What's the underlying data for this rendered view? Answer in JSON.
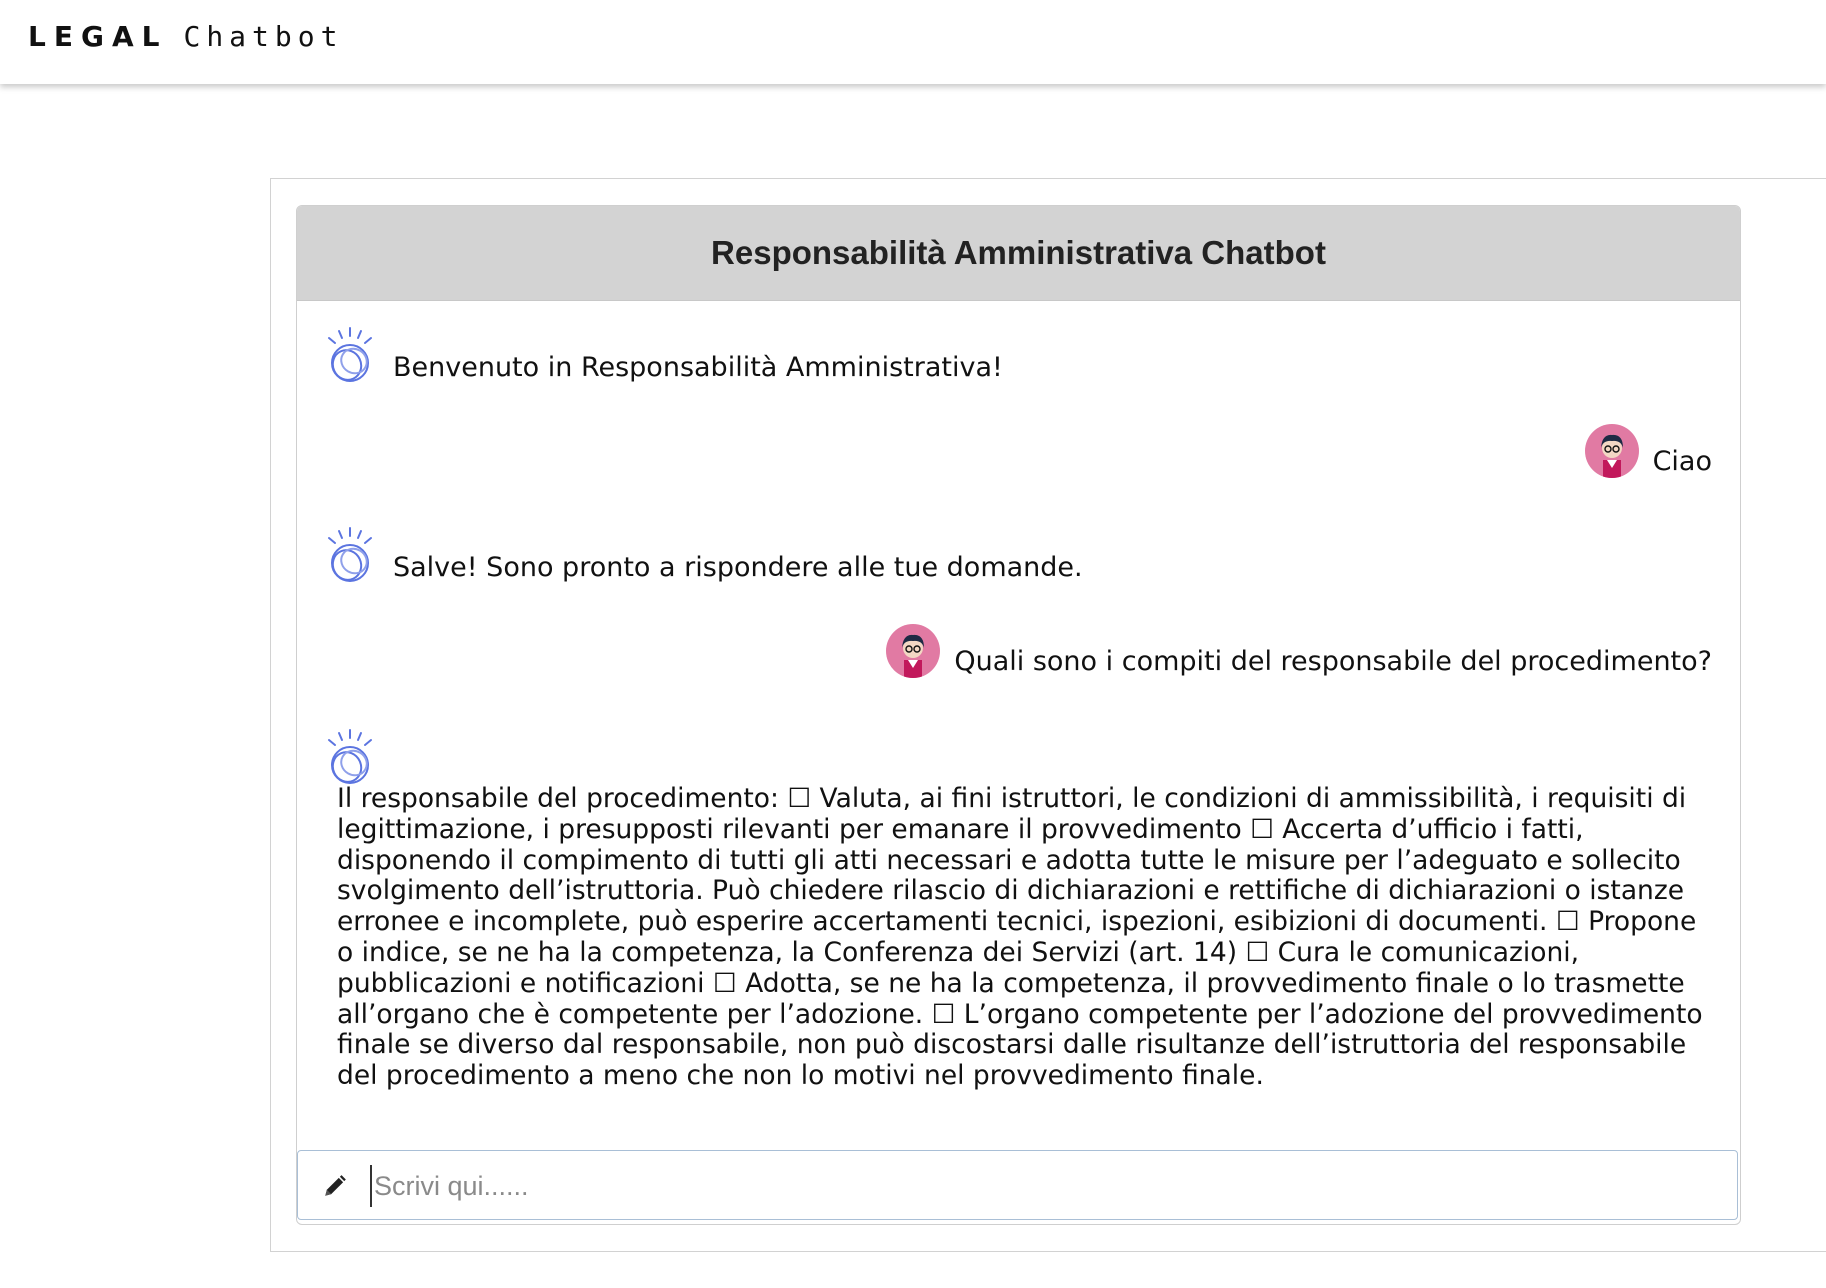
{
  "topbar": {
    "brand_bold": "LEGAL",
    "brand_rest": "Chatbot"
  },
  "chat": {
    "title": "Responsabilità Amministrativa Chatbot",
    "messages": [
      {
        "from": "bot",
        "text": "Benvenuto in Responsabilità Amministrativa!"
      },
      {
        "from": "user",
        "text": "Ciao"
      },
      {
        "from": "bot",
        "text": "Salve! Sono pronto a rispondere alle tue domande."
      },
      {
        "from": "user",
        "text": "Quali sono i compiti del responsabile del procedimento?"
      },
      {
        "from": "bot",
        "text": "Il responsabile del procedimento: ☐ Valuta, ai fini istruttori, le condizioni di ammissibilità, i requisiti di legittimazione, i presupposti rilevanti per emanare il provvedimento ☐ Accerta d’ufficio i fatti, disponendo il compimento di tutti gli atti necessari e adotta tutte le misure per l’adeguato e sollecito svolgimento dell’istruttoria. Può chiedere rilascio di dichiarazioni e rettifiche di dichiarazioni o istanze erronee e incomplete, può esperire accertamenti tecnici, ispezioni, esibizioni di documenti. ☐ Propone o indice, se ne ha la competenza, la Conferenza dei Servizi (art. 14) ☐ Cura le comunicazioni, pubblicazioni e notificazioni ☐ Adotta, se ne ha la competenza, il provvedimento finale o lo trasmette all’organo che è competente per l’adozione. ☐ L’organo competente per l’adozione del provvedimento finale se diverso dal responsabile, non può discostarsi dalle risultanze dell’istruttoria del responsabile del procedimento a meno che non lo motivi nel provvedimento finale."
      }
    ],
    "input": {
      "placeholder": "Scrivi qui......",
      "value": ""
    }
  },
  "icons": {
    "bot": "watson-bot-icon",
    "user": "user-avatar",
    "input": "pencil-icon"
  },
  "colors": {
    "header_bg": "#d3d3d3",
    "bot_icon": "#5b74e0",
    "avatar_bg": "#e17aa3",
    "input_border": "#a9bfd6"
  }
}
